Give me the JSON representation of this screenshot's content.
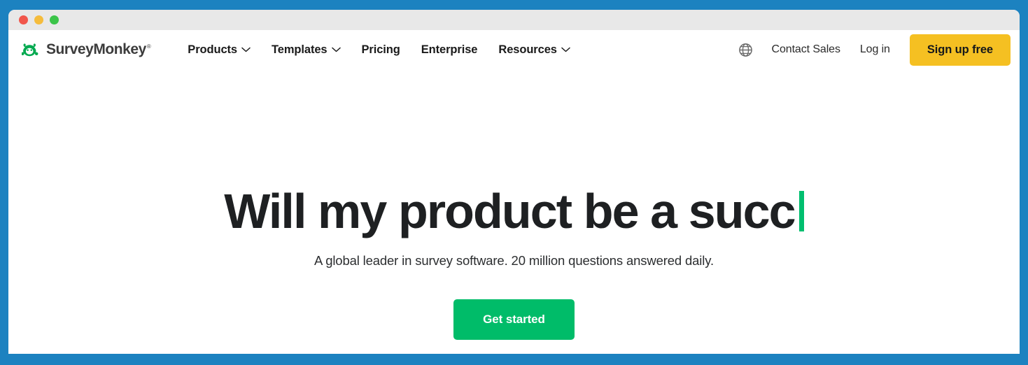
{
  "window": {
    "traffic_lights": [
      {
        "name": "close",
        "color": "#f1564b"
      },
      {
        "name": "minimize",
        "color": "#f5bc3c"
      },
      {
        "name": "maximize",
        "color": "#3bc449"
      }
    ],
    "backdrop_color": "#1c82c0",
    "titlebar_color": "#e8e8e8"
  },
  "nav": {
    "brand": {
      "name": "SurveyMonkey",
      "trademark": "®",
      "logo_icon": "surveymonkey-monkey-icon",
      "logo_color": "#00a94f",
      "text_color": "#3c3c3c"
    },
    "primary_items": [
      {
        "label": "Products",
        "has_dropdown": true
      },
      {
        "label": "Templates",
        "has_dropdown": true
      },
      {
        "label": "Pricing",
        "has_dropdown": false
      },
      {
        "label": "Enterprise",
        "has_dropdown": false
      },
      {
        "label": "Resources",
        "has_dropdown": true
      }
    ],
    "language_icon": "globe-icon",
    "contact_sales_label": "Contact Sales",
    "login_label": "Log in",
    "signup_label": "Sign up free",
    "signup_color": "#f5c022"
  },
  "hero": {
    "headline_typed": "Will my product be a succ",
    "caret_color": "#00bf6f",
    "subtitle": "A global leader in survey software. 20 million questions answered daily.",
    "cta_label": "Get started",
    "cta_color": "#00bc69"
  }
}
